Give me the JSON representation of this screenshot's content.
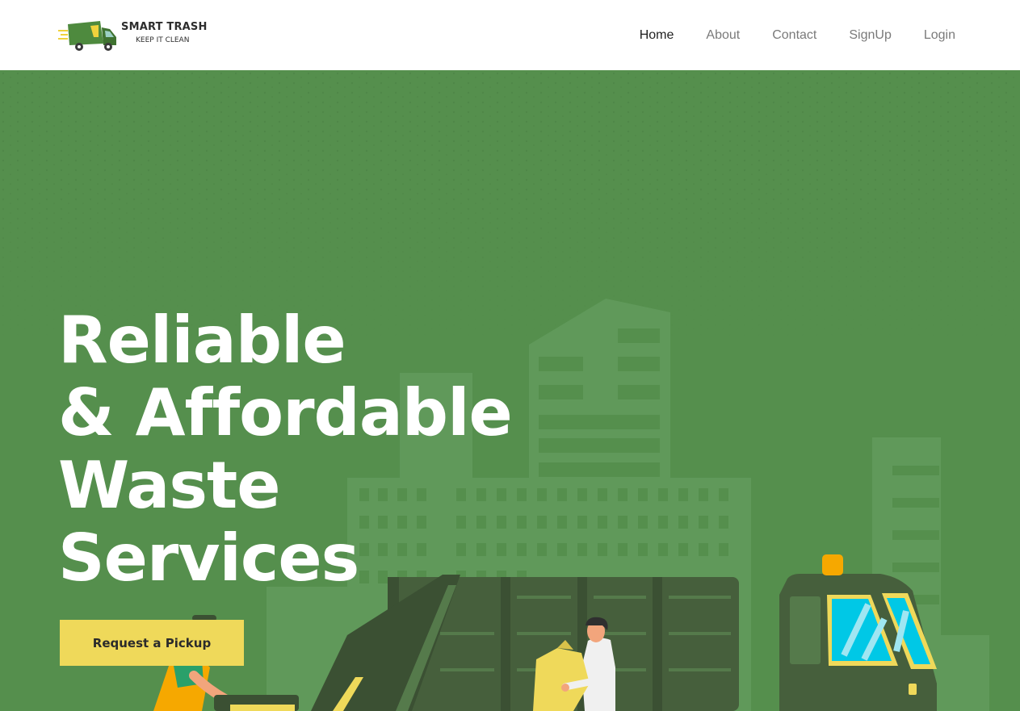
{
  "brand": {
    "title": "SMART TRASH",
    "tagline": "KEEP IT CLEAN",
    "colors": {
      "truck": "#4e8a3e",
      "speed_lines": "#f0d23c",
      "wheel": "#3a3a3a"
    }
  },
  "nav": {
    "items": [
      {
        "label": "Home",
        "active": true
      },
      {
        "label": "About",
        "active": false
      },
      {
        "label": "Contact",
        "active": false
      },
      {
        "label": "SignUp",
        "active": false
      },
      {
        "label": "Login",
        "active": false
      }
    ]
  },
  "hero": {
    "title_lines": [
      "Reliable",
      "& Affordable",
      "Waste",
      "Services"
    ],
    "cta_label": "Request a Pickup",
    "colors": {
      "background": "#558f4d",
      "buildings": "#60995a",
      "truck_body": "#465f3c",
      "truck_dark": "#3b5033",
      "window_blue": "#00c8e6",
      "accent_yellow": "#efd95a",
      "beacon": "#f6a800"
    }
  }
}
